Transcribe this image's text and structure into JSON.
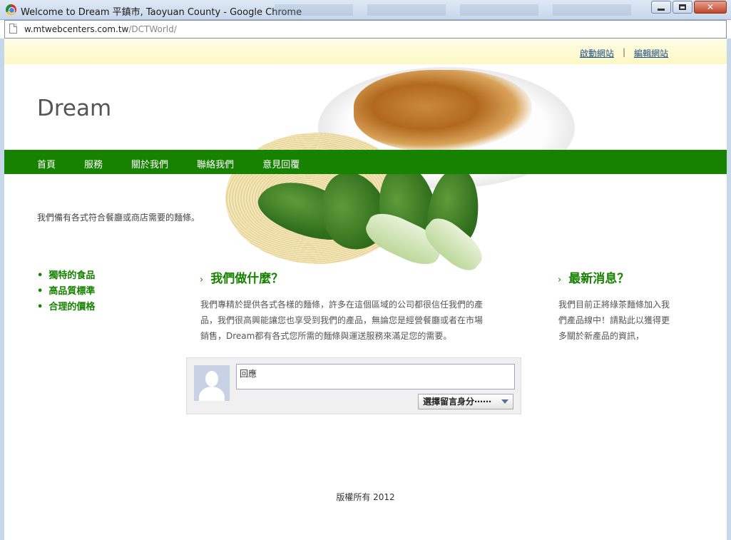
{
  "window": {
    "title": "Welcome to Dream 平鎮市, Taoyuan County - Google Chrome",
    "close_glyph": "✕"
  },
  "address_bar": {
    "host": "w.mtwebcenters.com.tw",
    "path": "/DCTWorld/"
  },
  "top_links": {
    "launch": "啟動網站",
    "separator": "|",
    "edit": "編輯網站"
  },
  "site": {
    "logo": "Dream",
    "tagline": "我們備有各式符合餐廳或商店需要的麵條。"
  },
  "nav": {
    "items": [
      "首頁",
      "服務",
      "關於我們",
      "聯絡我們",
      "意見回覆"
    ]
  },
  "features": [
    "獨特的食品",
    "高品質標準",
    "合理的價格"
  ],
  "what_we_do": {
    "chevron": "›",
    "heading": "我們做什麼？",
    "line1": "我們專精於提供各式各樣的麵條，許多在這個區域的公司都很信任我們的產",
    "line2": "品，我們很高興能讓您也享受到我們的產品，無論您是經營餐廳或者在市場",
    "line3": "銷售，Dream都有各式您所需的麵條與運送服務來滿足您的需要。"
  },
  "news": {
    "chevron": "›",
    "heading": "最新消息？",
    "line1": "我們目前正將綠茶麵條加入我",
    "line2": "們產品線中！請點此以獲得更",
    "line3": "多關於新產品的資訊，"
  },
  "comment": {
    "placeholder": "回應",
    "identity_label": "選擇留言身分⋯⋯"
  },
  "footer": {
    "copyright": "版權所有 2012"
  },
  "colors": {
    "nav_green": "#168200",
    "link_blue": "#1b4f8a",
    "top_strip": "#fdf7c4"
  }
}
